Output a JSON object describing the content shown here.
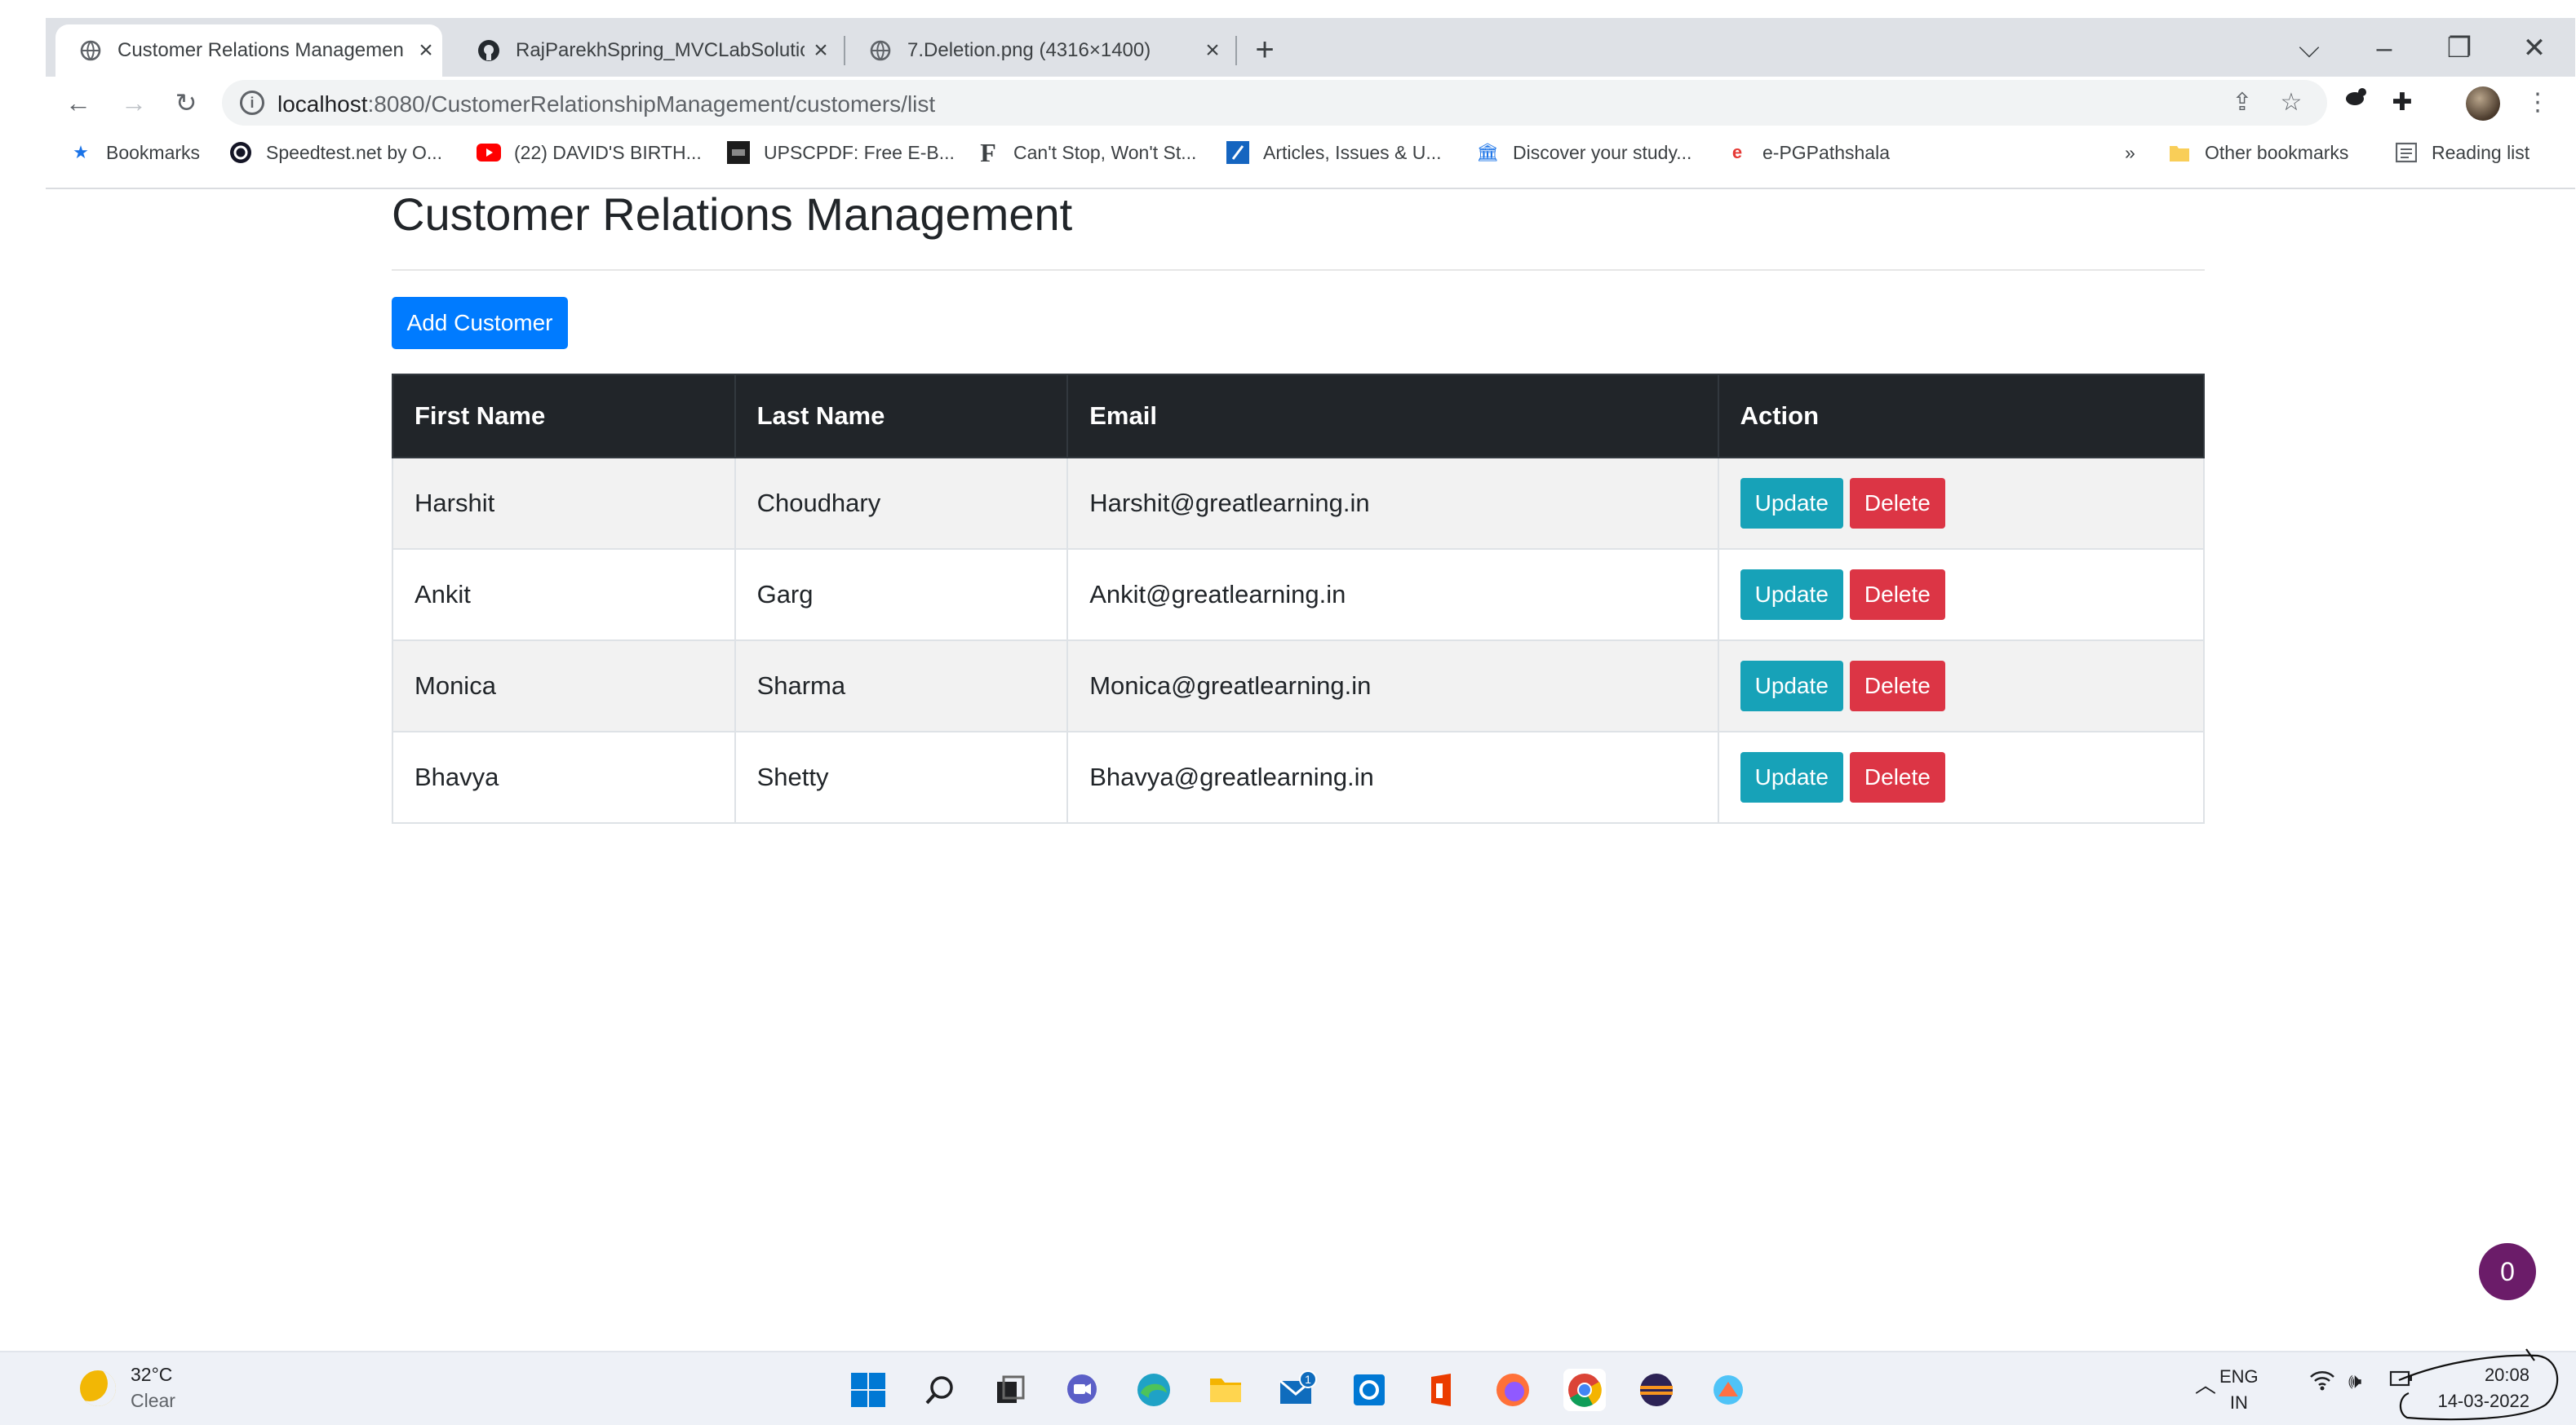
{
  "browser": {
    "tabs": [
      {
        "title": "Customer Relations Managemen",
        "icon": "globe-icon"
      },
      {
        "title": "RajParekhSpring_MVCLabSolutio",
        "icon": "github-icon"
      },
      {
        "title": "7.Deletion.png (4316×1400)",
        "icon": "globe-icon"
      }
    ],
    "new_tab": "+",
    "url_host": "localhost",
    "url_rest": ":8080/CustomerRelationshipManagement/customers/list",
    "bookmarks": [
      {
        "label": "Bookmarks",
        "icon": "star-icon"
      },
      {
        "label": "Speedtest.net by O...",
        "icon": "speedtest-icon"
      },
      {
        "label": "(22) DAVID'S BIRTH...",
        "icon": "youtube-icon"
      },
      {
        "label": "UPSCPDF: Free E-B...",
        "icon": "upscpdf-icon"
      },
      {
        "label": "Can't Stop, Won't St...",
        "icon": "f-icon"
      },
      {
        "label": "Articles, Issues & U...",
        "icon": "articles-icon"
      },
      {
        "label": "Discover your study...",
        "icon": "library-icon"
      },
      {
        "label": "e-PGPathshala",
        "icon": "epg-icon"
      }
    ],
    "bookmarks_overflow": "»",
    "other_bookmarks": "Other bookmarks",
    "reading_list": "Reading list"
  },
  "page": {
    "title": "Customer Relations Management",
    "add_button": "Add Customer",
    "table": {
      "headers": [
        "First Name",
        "Last Name",
        "Email",
        "Action"
      ],
      "rows": [
        {
          "first": "Harshit",
          "last": "Choudhary",
          "email": "Harshit@greatlearning.in"
        },
        {
          "first": "Ankit",
          "last": "Garg",
          "email": "Ankit@greatlearning.in"
        },
        {
          "first": "Monica",
          "last": "Sharma",
          "email": "Monica@greatlearning.in"
        },
        {
          "first": "Bhavya",
          "last": "Shetty",
          "email": "Bhavya@greatlearning.in"
        }
      ],
      "update_label": "Update",
      "delete_label": "Delete"
    },
    "badge_count": "0"
  },
  "taskbar": {
    "weather_temp": "32°C",
    "weather_cond": "Clear",
    "lang_top": "ENG",
    "lang_bottom": "IN",
    "time": "20:08",
    "date": "14-03-2022",
    "mail_badge": "1"
  },
  "colors": {
    "primary": "#007bff",
    "info": "#17a2b8",
    "danger": "#dc3545",
    "table_header": "#212529",
    "badge": "#6b1c69"
  }
}
